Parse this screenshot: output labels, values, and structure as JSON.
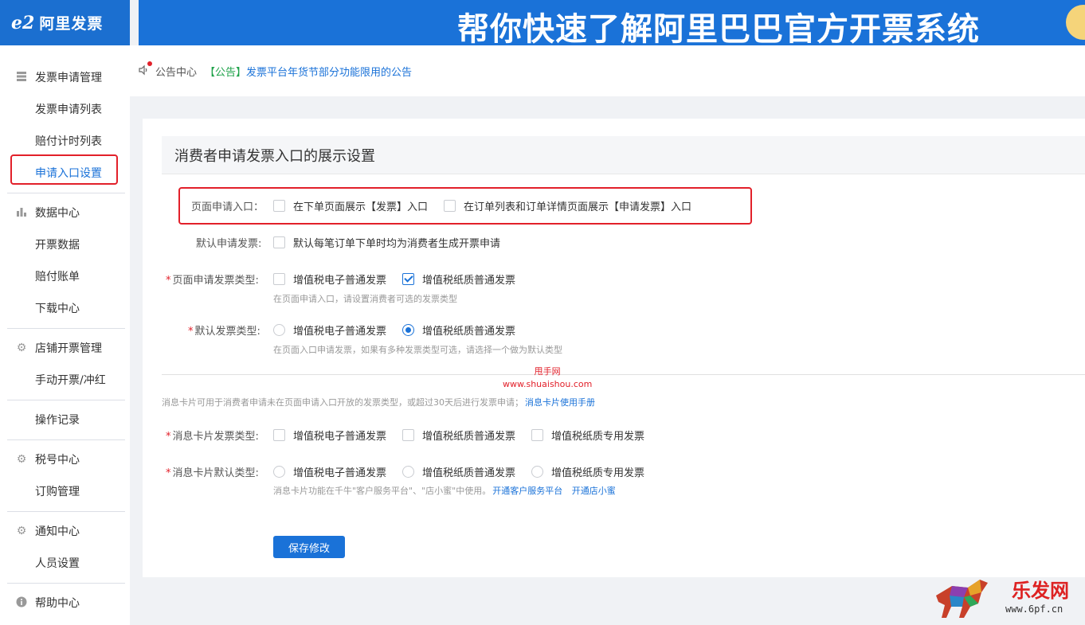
{
  "header": {
    "logo_mark": "e2",
    "logo_text": "阿里发票",
    "banner_text": "帮你快速了解阿里巴巴官方开票系统"
  },
  "sidebar": {
    "items": [
      {
        "label": "发票申请管理",
        "icon": "invoice-icon"
      },
      {
        "label": "发票申请列表"
      },
      {
        "label": "赔付计时列表"
      },
      {
        "label": "申请入口设置"
      },
      {
        "label": "数据中心",
        "icon": "bar-chart-icon"
      },
      {
        "label": "开票数据"
      },
      {
        "label": "赔付账单"
      },
      {
        "label": "下载中心"
      },
      {
        "label": "店铺开票管理",
        "icon": "gear-icon"
      },
      {
        "label": "手动开票/冲红"
      },
      {
        "label": "操作记录"
      },
      {
        "label": "税号中心",
        "icon": "gear-icon"
      },
      {
        "label": "订购管理"
      },
      {
        "label": "通知中心",
        "icon": "gear-icon"
      },
      {
        "label": "人员设置"
      },
      {
        "label": "帮助中心",
        "icon": "info-icon"
      }
    ]
  },
  "notice": {
    "label": "公告中心",
    "tag": "【公告】",
    "text": "发票平台年货节部分功能限用的公告"
  },
  "panel": {
    "title": "消费者申请发票入口的展示设置",
    "entry": {
      "label": "页面申请入口：",
      "opt1": "在下单页面展示【发票】入口",
      "opt2": "在订单列表和订单详情页面展示【申请发票】入口"
    },
    "default_apply": {
      "label": "默认申请发票:",
      "opt1": "默认每笔订单下单时均为消费者生成开票申请"
    },
    "page_type": {
      "req": "*",
      "label": "页面申请发票类型:",
      "opt1": "增值税电子普通发票",
      "opt2": "增值税纸质普通发票",
      "hint": "在页面申请入口，请设置消费者可选的发票类型"
    },
    "default_type": {
      "req": "*",
      "label": "默认发票类型:",
      "opt1": "增值税电子普通发票",
      "opt2": "增值税纸质普通发票",
      "hint": "在页面入口申请发票，如果有多种发票类型可选，请选择一个做为默认类型"
    },
    "card_note": {
      "text": "消息卡片可用于消费者申请未在页面申请入口开放的发票类型，或超过30天后进行发票申请；",
      "link": "消息卡片使用手册"
    },
    "card_type": {
      "req": "*",
      "label": "消息卡片发票类型:",
      "opt1": "增值税电子普通发票",
      "opt2": "增值税纸质普通发票",
      "opt3": "增值税纸质专用发票"
    },
    "card_default": {
      "req": "*",
      "label": "消息卡片默认类型:",
      "opt1": "增值税电子普通发票",
      "opt2": "增值税纸质普通发票",
      "opt3": "增值税纸质专用发票",
      "hint": "消息卡片功能在千牛\"客户服务平台\"、\"店小蜜\"中使用。",
      "link1": "开通客户服务平台",
      "link2": "开通店小蜜"
    },
    "save_label": "保存修改"
  },
  "watermark": {
    "line1": "甩手网",
    "line2": "www.shuaishou.com"
  },
  "corner": {
    "title": "乐发网",
    "url": "www.6pf.cn"
  },
  "colors": {
    "brand_blue": "#1a72d8",
    "highlight_red": "#e2202a"
  }
}
